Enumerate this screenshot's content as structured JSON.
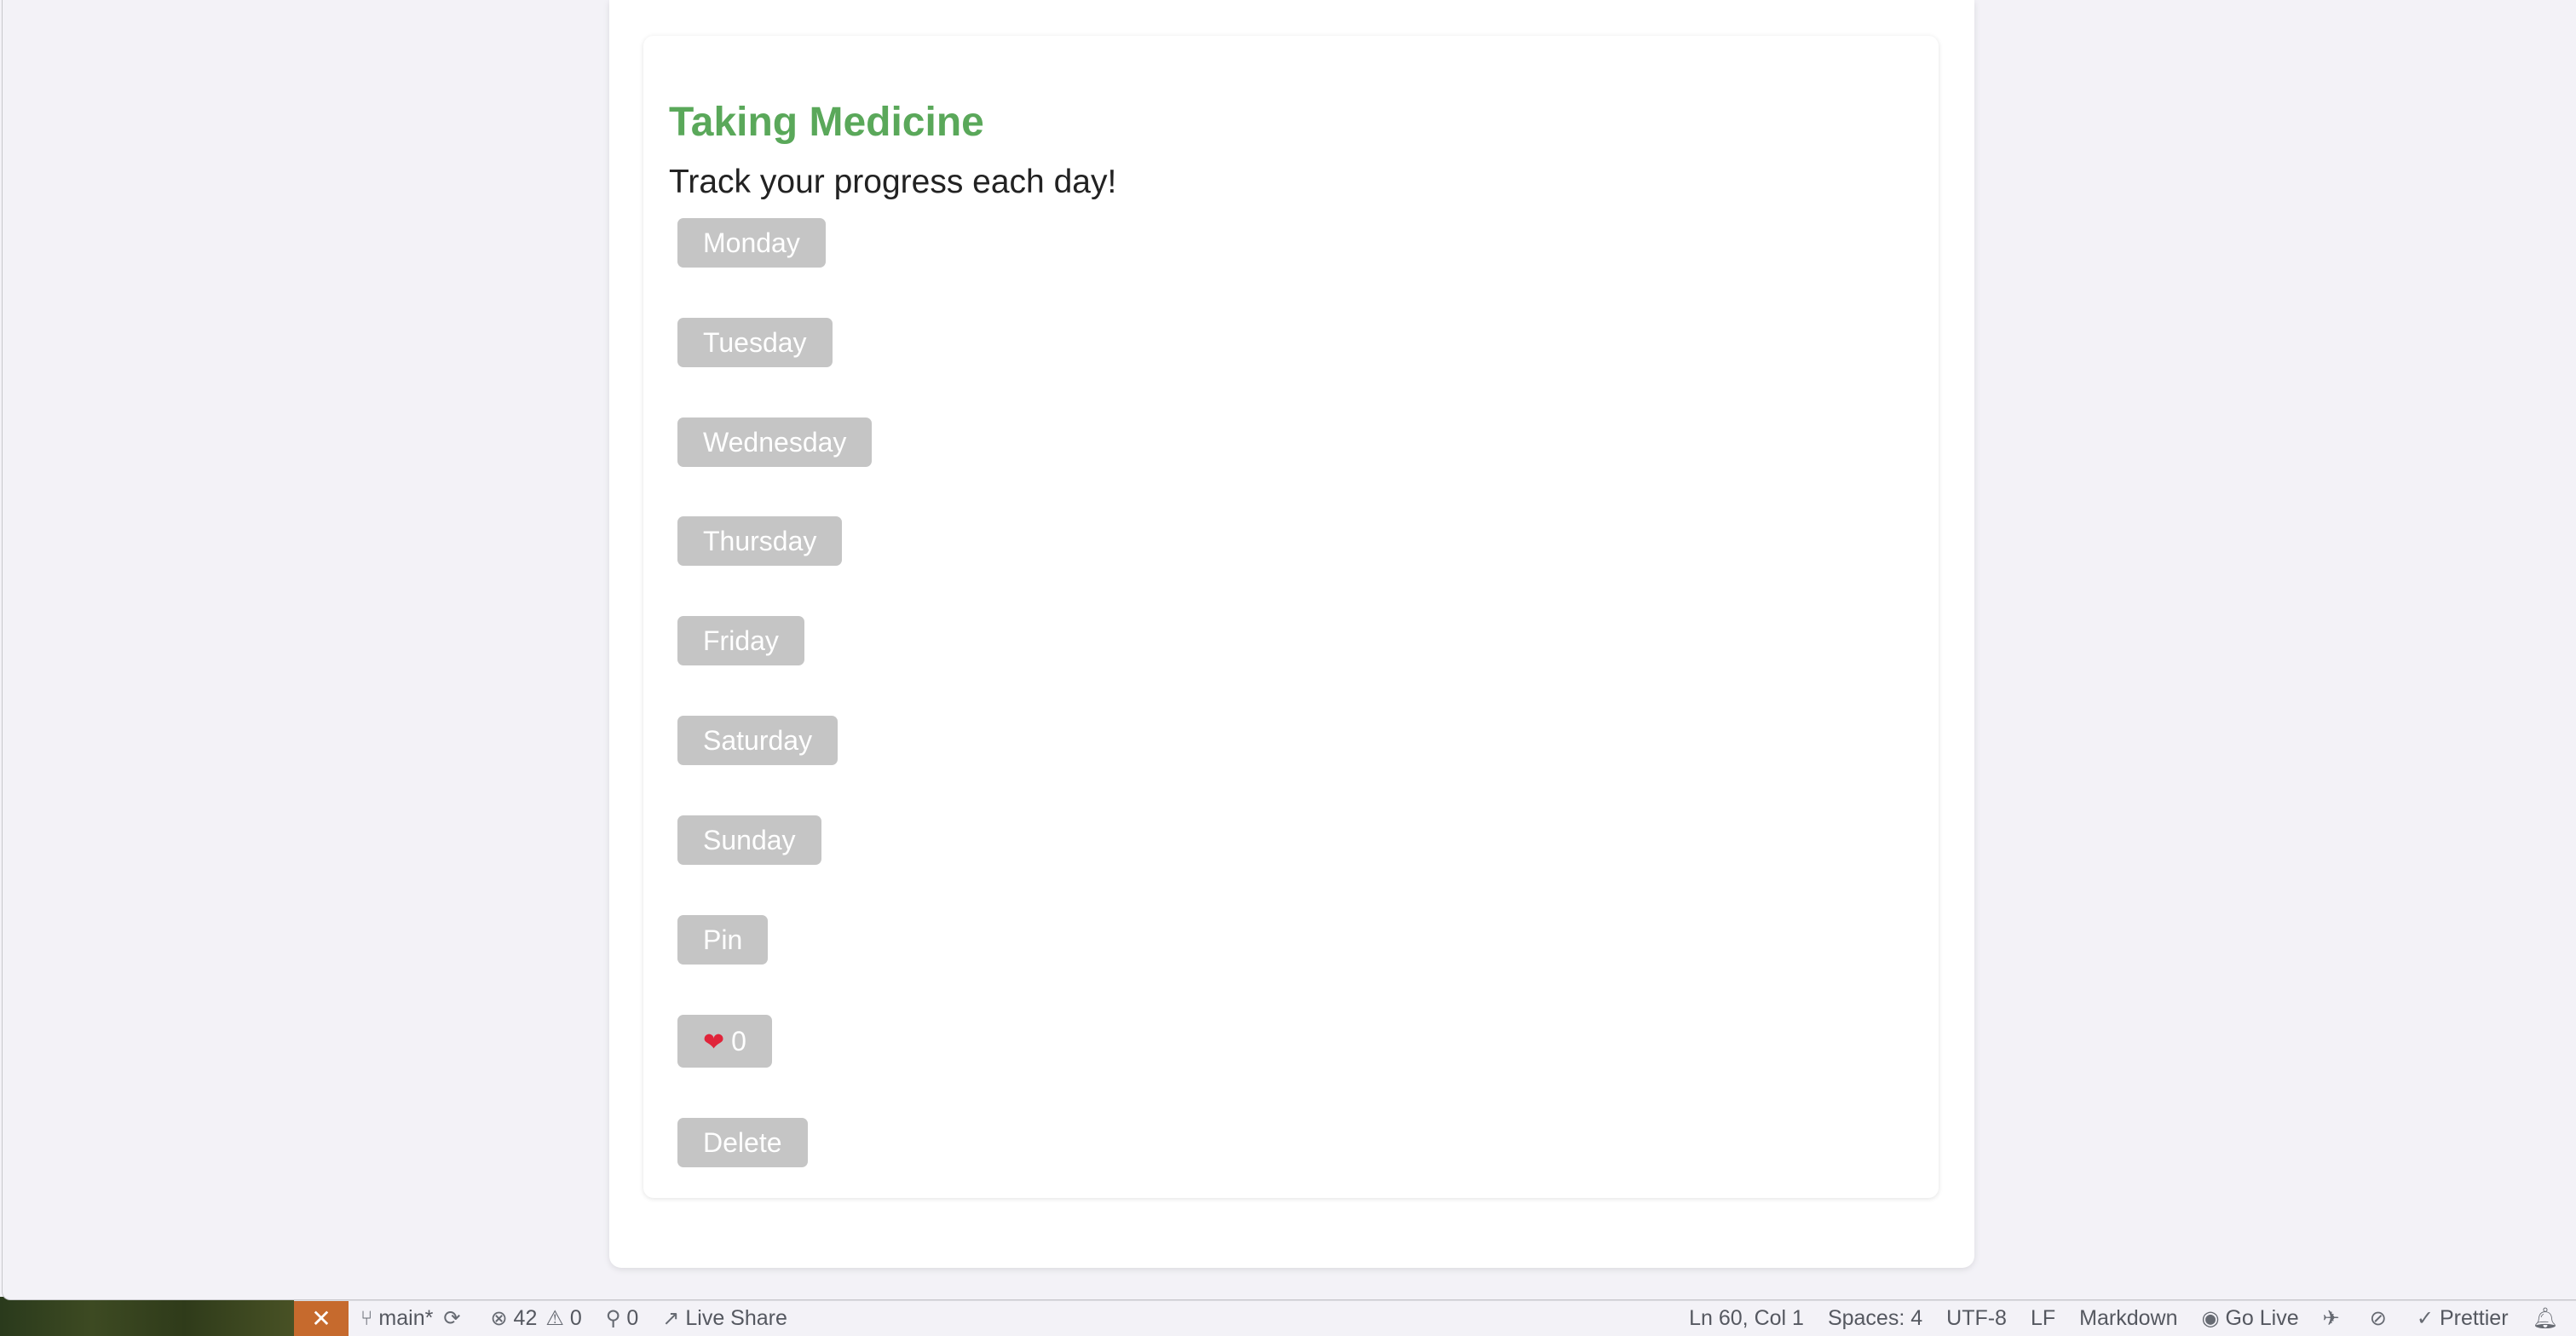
{
  "card": {
    "title": "Taking Medicine",
    "subtitle": "Track your progress each day!"
  },
  "days": [
    "Monday",
    "Tuesday",
    "Wednesday",
    "Thursday",
    "Friday",
    "Saturday",
    "Sunday"
  ],
  "actions": {
    "pin_label": "Pin",
    "like_count": "0",
    "delete_label": "Delete"
  },
  "colors": {
    "title": "#5aa85a",
    "button_bg": "#c5c5c5",
    "remote_indicator": "#c66a2d"
  },
  "status_bar": {
    "branch": "main*",
    "errors": "42",
    "warnings": "0",
    "ports": "0",
    "live_share": "Live Share",
    "cursor": "Ln 60, Col 1",
    "spaces": "Spaces: 4",
    "encoding": "UTF-8",
    "eol": "LF",
    "language": "Markdown",
    "go_live": "Go Live",
    "prettier": "Prettier"
  }
}
